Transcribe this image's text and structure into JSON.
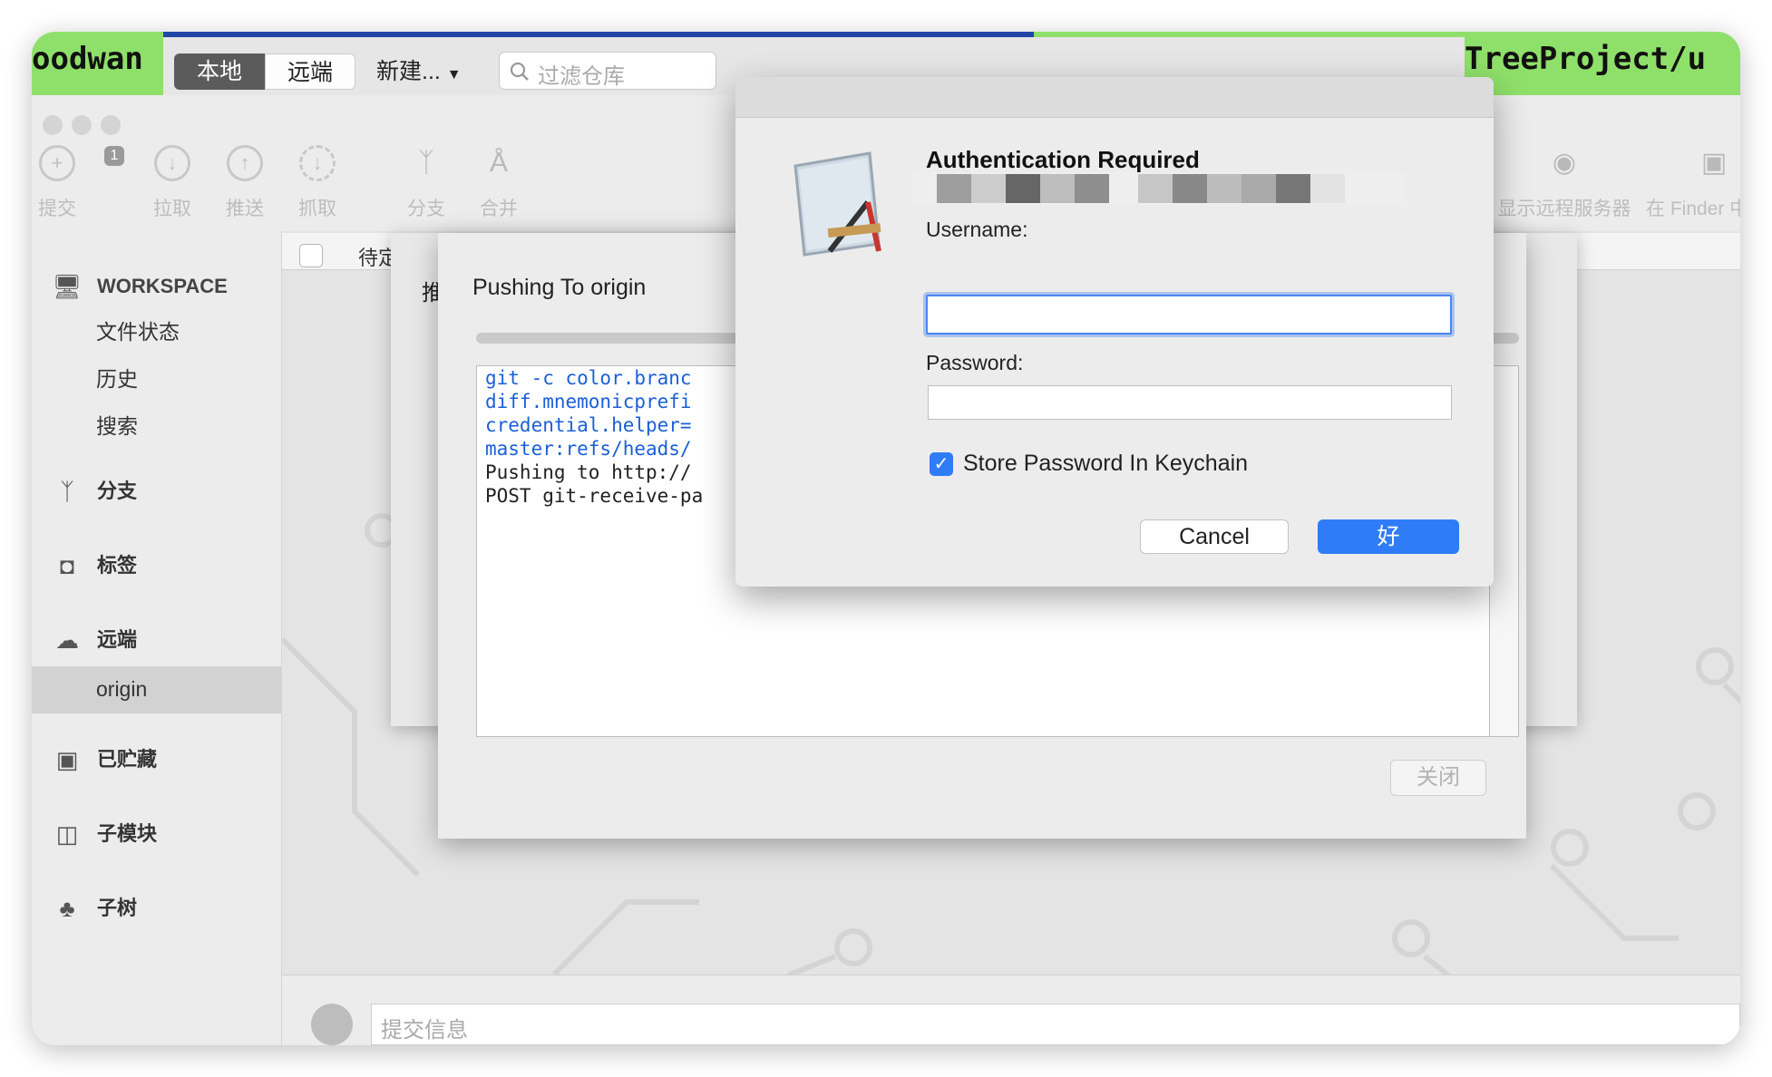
{
  "terminal": {
    "left_text": "oodwan",
    "right_text": "TreeProject/u"
  },
  "topbar": {
    "segments": [
      "本地",
      "远端"
    ],
    "new_button": "新建...",
    "filter_placeholder": "过滤仓库"
  },
  "toolbar": {
    "badge_count": "1",
    "buttons": [
      {
        "label": "提交",
        "icon": "plus-icon"
      },
      {
        "label": "拉取",
        "icon": "pull-icon"
      },
      {
        "label": "推送",
        "icon": "push-icon"
      },
      {
        "label": "抓取",
        "icon": "fetch-icon"
      },
      {
        "label": "分支",
        "icon": "branch-icon"
      },
      {
        "label": "合并",
        "icon": "merge-icon"
      },
      {
        "label": "显示远程服务器",
        "icon": "globe-icon"
      },
      {
        "label": "在 Finder 中显",
        "icon": "finder-icon"
      }
    ]
  },
  "sidebar": {
    "workspace": "WORKSPACE",
    "workspace_items": [
      "文件状态",
      "历史",
      "搜索"
    ],
    "sections": {
      "branches": "分支",
      "tags": "标签",
      "remotes": "远端",
      "remote_origin": "origin",
      "stashes": "已贮藏",
      "submodules": "子模块",
      "subtrees": "子树"
    }
  },
  "main": {
    "pending_label": "待定",
    "commit_placeholder": "提交信息"
  },
  "back_sheet": {
    "fragment": "推"
  },
  "push_dialog": {
    "title": "Pushing To origin",
    "log_lines": [
      "git -c color.branc",
      "diff.mnemonicprefi",
      "credential.helper=",
      "master:refs/heads/",
      "Pushing to http://",
      "POST git-receive-pa"
    ],
    "close_button": "关闭"
  },
  "auth_dialog": {
    "title": "Authentication Required",
    "username_label": "Username:",
    "password_label": "Password:",
    "keychain_label": "Store Password In Keychain",
    "keychain_checked": true,
    "cancel_button": "Cancel",
    "ok_button": "好"
  },
  "colors": {
    "accent": "#2f7cf6",
    "terminal_green": "#8fe06a",
    "code_blue": "#1b5fd6"
  }
}
